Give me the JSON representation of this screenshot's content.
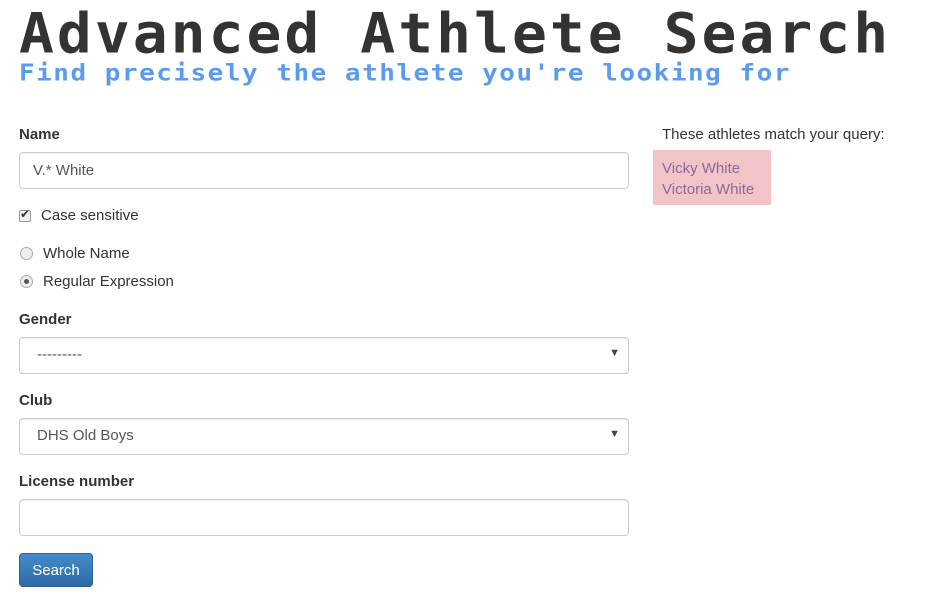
{
  "header": {
    "title": "Advanced Athlete Search",
    "subtitle": "Find precisely the athlete you're looking for"
  },
  "form": {
    "name": {
      "label": "Name",
      "value": "V.* White"
    },
    "case_sensitive": {
      "label": "Case sensitive",
      "checked": true
    },
    "match_mode": {
      "options": [
        "Whole Name",
        "Regular Expression"
      ],
      "selected": "Regular Expression"
    },
    "gender": {
      "label": "Gender",
      "selected": "---------"
    },
    "club": {
      "label": "Club",
      "selected": "DHS Old Boys"
    },
    "license": {
      "label": "License number",
      "value": ""
    },
    "search_label": "Search"
  },
  "results": {
    "heading": "These athletes match your query:",
    "items": [
      "Vicky White",
      "Victoria White"
    ]
  },
  "colors": {
    "subtitle": "#5b9bef",
    "result_bg": "#f2c4c8",
    "result_link": "#8a6a9c",
    "button": "#337ab7"
  }
}
